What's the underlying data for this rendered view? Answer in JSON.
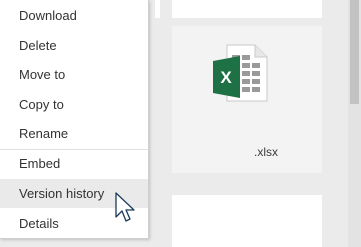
{
  "menu": {
    "items": [
      {
        "label": "Download"
      },
      {
        "label": "Delete"
      },
      {
        "label": "Move to"
      },
      {
        "label": "Copy to"
      },
      {
        "label": "Rename"
      },
      {
        "label": "Embed"
      },
      {
        "label": "Version history"
      },
      {
        "label": "Details"
      }
    ]
  },
  "file": {
    "name": ".xlsx",
    "icon": "excel-file-icon",
    "icon_letter": "X"
  },
  "colors": {
    "excel_green": "#1e7145",
    "menu_hover": "#eaeaea",
    "background": "#ebebeb"
  },
  "cursor": {
    "icon": "mouse-pointer-icon"
  }
}
